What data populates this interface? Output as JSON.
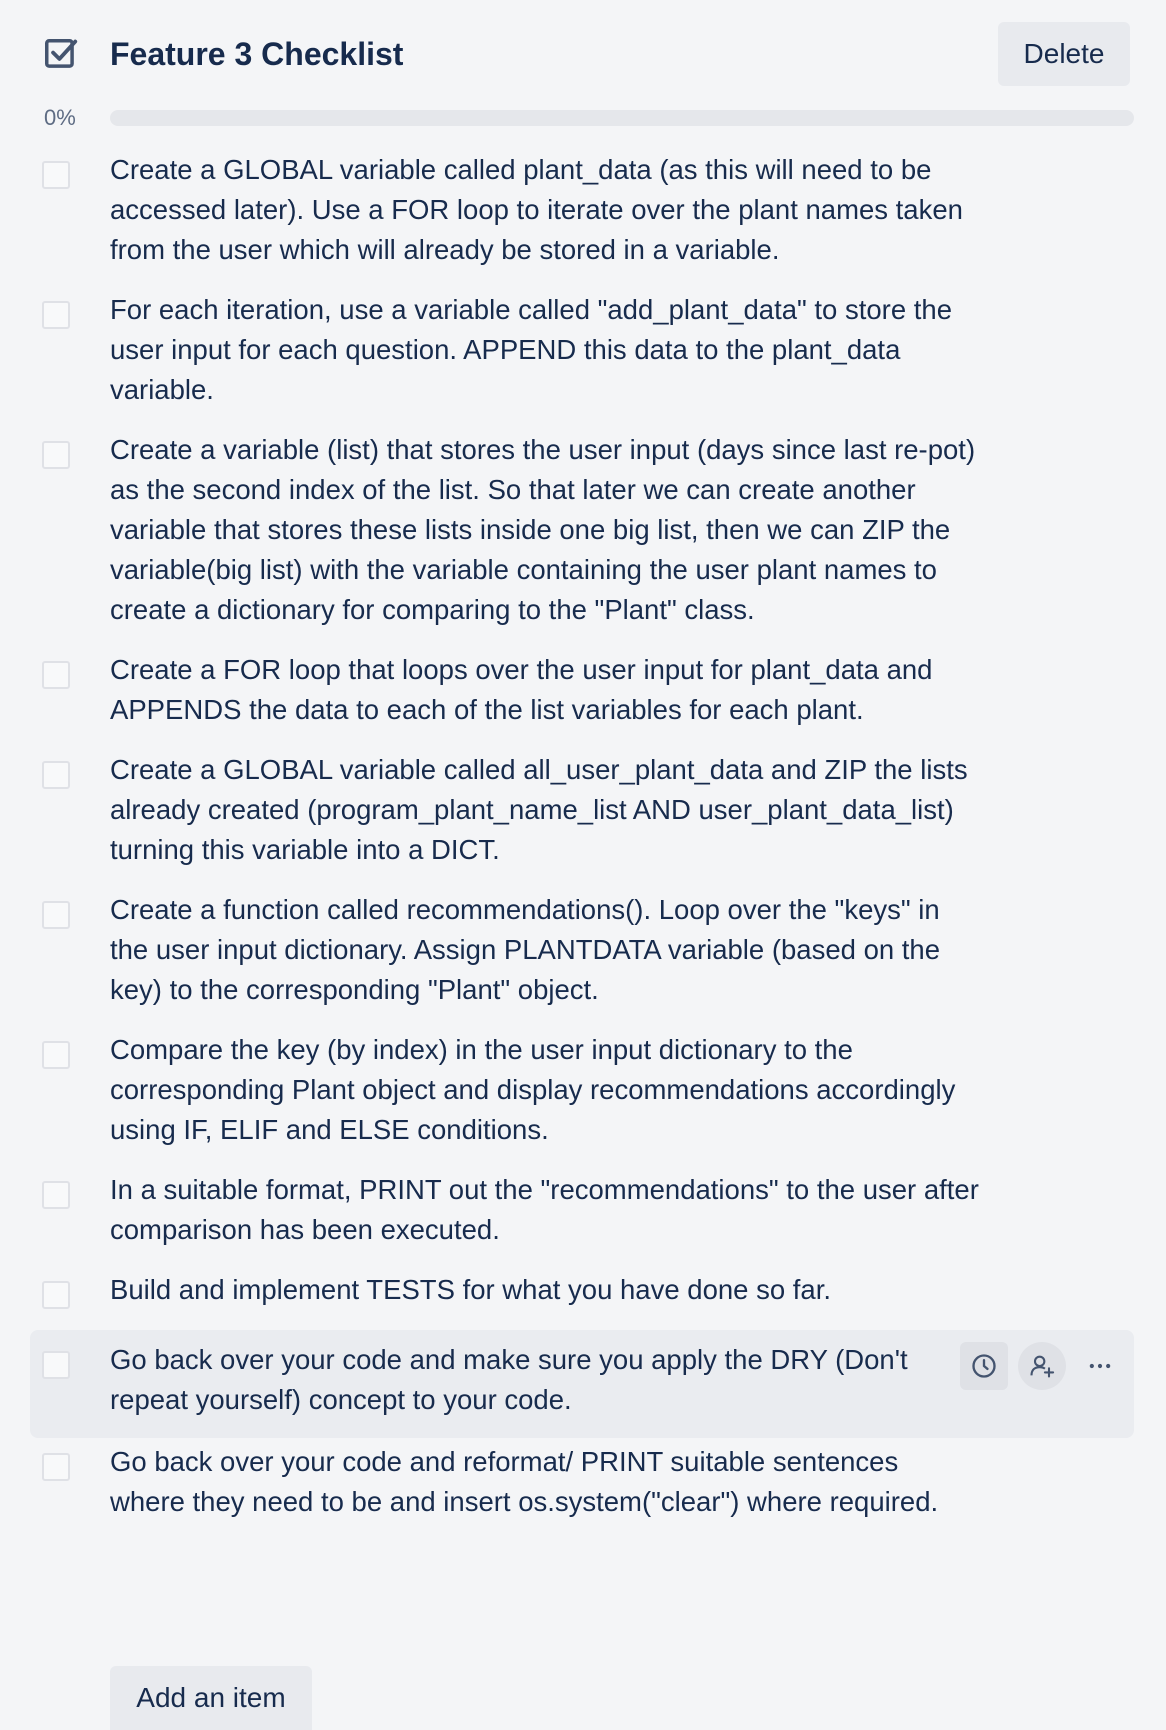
{
  "checklist": {
    "title": "Feature 3 Checklist",
    "delete_label": "Delete",
    "progress_label": "0%",
    "progress_fraction": 0,
    "add_item_label": "Add an item",
    "items": [
      {
        "text": "Create a GLOBAL variable called plant_data (as this will need to be accessed later). Use a FOR loop to iterate over the plant names taken from the user which will already be stored in a variable.",
        "checked": false
      },
      {
        "text": "For each iteration, use a variable called \"add_plant_data\" to store the user input for each question. APPEND this data to the plant_data variable.",
        "checked": false
      },
      {
        "text": "Create a variable (list) that stores the user input (days since last re-pot) as the second index of the list. So that later we can create another variable that stores these lists inside one big list, then we can ZIP the variable(big list) with the variable containing the user plant names to create a dictionary for comparing to the \"Plant\" class.",
        "checked": false
      },
      {
        "text": "Create a FOR loop that loops over the user input for plant_data and APPENDS the data to each of the list variables for each plant.",
        "checked": false
      },
      {
        "text": "Create a GLOBAL variable called all_user_plant_data and ZIP the lists already created (program_plant_name_list AND user_plant_data_list) turning this variable into a DICT.",
        "checked": false
      },
      {
        "text": "Create a function called recommendations(). Loop over the \"keys\" in the user input dictionary. Assign PLANTDATA variable (based on the key) to the corresponding \"Plant\" object.",
        "checked": false
      },
      {
        "text": "Compare the key (by index) in the user input dictionary to the corresponding Plant object and display recommendations accordingly using IF, ELIF and ELSE conditions.",
        "checked": false
      },
      {
        "text": "In a suitable format, PRINT out the \"recommendations\" to the user after comparison has been executed.",
        "checked": false
      },
      {
        "text": "Build and implement TESTS for what you have done so far.",
        "checked": false
      },
      {
        "text": "Go back over your code and make sure you apply the DRY (Don't repeat yourself) concept to your code.",
        "checked": false
      },
      {
        "text": "Go back over your code and reformat/ PRINT suitable sentences where they need to be and insert os.system(\"clear\") where required.",
        "checked": false
      }
    ],
    "hovered_item_actions": {
      "due_date_icon": "clock-icon",
      "assign_icon": "add-member-icon",
      "more_icon": "more-horizontal-icon"
    }
  },
  "colors": {
    "background": "#f4f5f7",
    "text": "#172b4d",
    "muted_text": "#5e6c84",
    "button_bg": "#e8eaee",
    "hover_row_bg": "#eaecf0",
    "progress_track": "#e5e7eb"
  }
}
